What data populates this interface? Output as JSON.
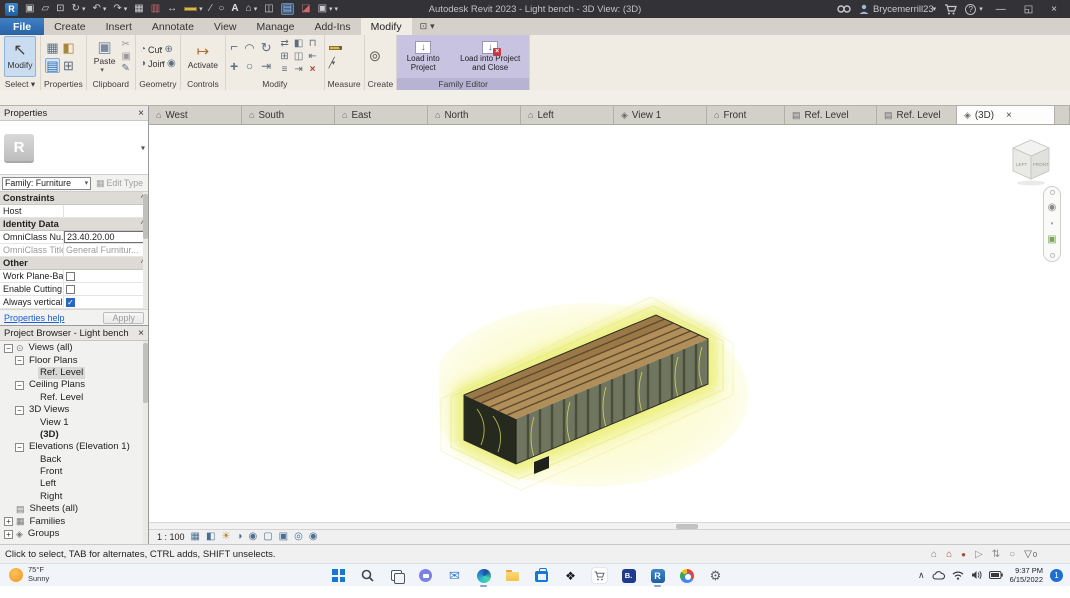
{
  "titlebar": {
    "title": "Autodesk Revit 2023 - Light bench - 3D View: (3D)",
    "user": "Brycemerrill23",
    "help": "?"
  },
  "ribbon": {
    "tabs": [
      "File",
      "Create",
      "Insert",
      "Annotate",
      "View",
      "Manage",
      "Add-Ins",
      "Modify"
    ],
    "panel_labels": {
      "select": "Select",
      "properties": "Properties",
      "clipboard": "Clipboard",
      "geometry": "Geometry",
      "controls": "Controls",
      "modify": "Modify",
      "measure": "Measure",
      "create": "Create",
      "family_editor": "Family Editor"
    },
    "buttons": {
      "modify": "Modify",
      "paste": "Paste",
      "cut": "Cut",
      "join": "Join",
      "activate": "Activate",
      "load_into_project": "Load into Project",
      "load_into_project_and_close": "Load into Project and Close"
    }
  },
  "view_tabs": [
    {
      "label": "West"
    },
    {
      "label": "South"
    },
    {
      "label": "East"
    },
    {
      "label": "North"
    },
    {
      "label": "Left"
    },
    {
      "label": "View 1"
    },
    {
      "label": "Front"
    },
    {
      "label": "Ref. Level"
    },
    {
      "label": "Ref. Level"
    },
    {
      "label": "(3D)"
    }
  ],
  "properties": {
    "header": "Properties",
    "type_selector": "Family: Furniture",
    "edit_type": "Edit Type",
    "sections": {
      "constraints": "Constraints",
      "identity": "Identity Data",
      "other": "Other"
    },
    "rows": {
      "host": {
        "label": "Host",
        "value": ""
      },
      "omniclass_number": {
        "label": "OmniClass Nu...",
        "value": "23.40.20.00"
      },
      "omniclass_title": {
        "label": "OmniClass Title",
        "value": "General Furnitur..."
      },
      "work_plane": {
        "label": "Work Plane-Bas..."
      },
      "enable_cutting": {
        "label": "Enable Cutting ..."
      },
      "always_vertical": {
        "label": "Always vertical"
      }
    },
    "help": "Properties help",
    "apply": "Apply"
  },
  "browser": {
    "header": "Project Browser - Light bench",
    "items": [
      {
        "label": "Views (all)"
      },
      {
        "label": "Floor Plans"
      },
      {
        "label": "Ref. Level"
      },
      {
        "label": "Ceiling Plans"
      },
      {
        "label": "Ref. Level"
      },
      {
        "label": "3D Views"
      },
      {
        "label": "View 1"
      },
      {
        "label": "(3D)"
      },
      {
        "label": "Elevations (Elevation 1)"
      },
      {
        "label": "Back"
      },
      {
        "label": "Front"
      },
      {
        "label": "Left"
      },
      {
        "label": "Right"
      },
      {
        "label": "Sheets (all)"
      },
      {
        "label": "Families"
      },
      {
        "label": "Groups"
      }
    ]
  },
  "canvas": {
    "scale": "1 : 100",
    "viewcube": {
      "left": "LEFT",
      "front": "FRONT"
    }
  },
  "statusbar": {
    "hint": "Click to select, TAB for alternates, CTRL adds, SHIFT unselects.",
    "filter_count": "0"
  },
  "taskbar": {
    "weather_temp": "75°F",
    "weather_desc": "Sunny",
    "time": "9:37 PM",
    "date": "6/15/2022",
    "badge": "1"
  },
  "icons": {
    "close": "×",
    "minimize": "—",
    "restore": "◱",
    "caret": "▾",
    "plus": "+",
    "minus": "−",
    "check": "✓",
    "pin": "^",
    "house": "⌂",
    "plan": "▤",
    "cube": "◈",
    "modify_arrow": "↖",
    "window": "▣",
    "open": "▱",
    "save": "⊡",
    "sync": "↻",
    "undo": "↶",
    "redo": "↷",
    "print": "▦",
    "transfer": "▥",
    "measure": "↔",
    "line": "∕",
    "circle": "○",
    "text": "A",
    "section": "◫",
    "list": "▤",
    "tag": "◪",
    "cut": "◔",
    "join": "◑",
    "paste": "▣",
    "clip_cut": "✂",
    "clip_match": "✎",
    "geo_box": "⊕",
    "geo_paint": "◉",
    "activate": "↦",
    "m_cope": "⌐",
    "m_move": "+",
    "m_arc": "◠",
    "m_circle": "○",
    "m_rotate": "↻",
    "m_align": "⇄",
    "m_mirror": "◧",
    "m_offset": "⇥",
    "m_array": "⊞",
    "m_mirror2": "◫",
    "m_pin": "⊓",
    "m_trim": "⇤",
    "m_split": "≡",
    "m_delete": "×",
    "measure_diag": "╱",
    "create_group": "⊚",
    "load_arrow": "↓",
    "prop_b1": "▦",
    "prop_b2": "◧",
    "prop_b3": "▤",
    "prop_b4": "⊞",
    "tree_views": "⊙",
    "tree_sheet": "▤",
    "tree_family": "▦",
    "tree_group": "◈",
    "vc_detail": "▦",
    "vc_style": "◧",
    "vc_sun": "☀",
    "vc_shadow": "◑",
    "vc_crop": "▢",
    "vc_cropvis": "▣",
    "vc_hide": "◎",
    "vc_reveal": "◉",
    "sb_house": "⌂",
    "sb_house2": "⌂",
    "sb_user": "●",
    "sb_link": "▷",
    "sb_sel": "⇅",
    "sb_gear": "○",
    "funnel": "▽",
    "mail": "✉",
    "dropbox": "❖",
    "gear": "⚙",
    "chevron": "∧",
    "revit_r": "R",
    "b_app": "B."
  }
}
